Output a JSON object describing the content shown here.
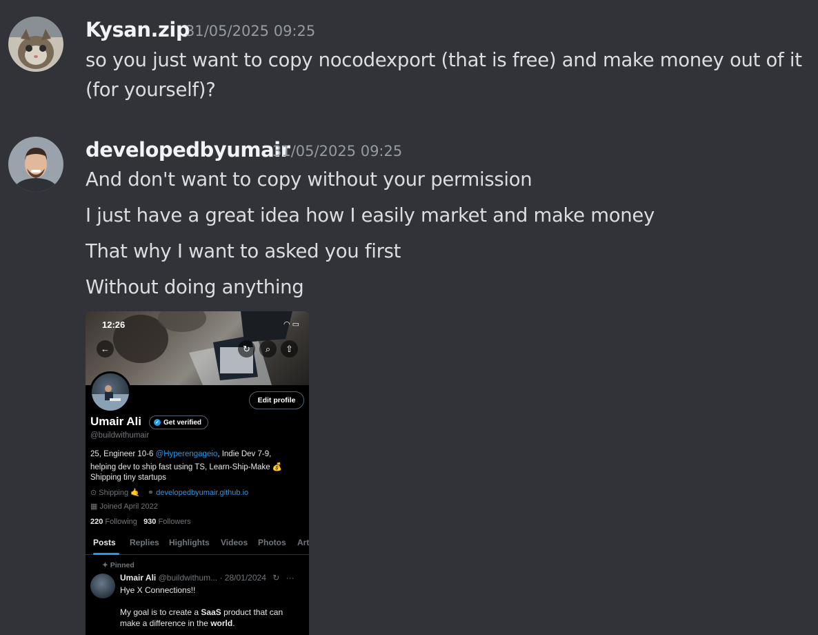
{
  "messages": [
    {
      "username": "Kysan.zip",
      "timestamp": "31/05/2025 09:25",
      "lines": [
        "so you just want to copy nocodexport (that is free) and make money out of it",
        "(for yourself)?"
      ]
    },
    {
      "username": "developedbyumair",
      "timestamp": "31/05/2025 09:25",
      "lines": [
        "And don't want to copy without your permission",
        "I just have a great idea how I easily market and make money",
        "That why I want to asked you first",
        "Without doing anything"
      ]
    }
  ],
  "attachment": {
    "status_time": "12:26",
    "edit_profile": "Edit profile",
    "name": "Umair Ali",
    "get_verified": "Get verified",
    "handle": "@buildwithumair",
    "bio": {
      "line1_pre": "25, Engineer 10-6 ",
      "line1_mention": "@Hyperengageio",
      "line1_post": ", Indie Dev 7-9,",
      "line2": "helping dev to ship fast using TS, Learn-Ship-Make 💰",
      "line3": "Shipping tiny startups"
    },
    "location": "Shipping 🤙",
    "website": "developedbyumair.github.io",
    "joined": "Joined April 2022",
    "following_count": "220",
    "following_label": "Following",
    "followers_count": "930",
    "followers_label": "Followers",
    "tabs": [
      "Posts",
      "Replies",
      "Highlights",
      "Videos",
      "Photos",
      "Art"
    ],
    "pinned_label": "Pinned",
    "post": {
      "name": "Umair Ali",
      "meta": "@buildwithum... · 28/01/2024",
      "line1": "Hye X Connections!!",
      "line2_pre": "My goal is to create a ",
      "line2_bold": "SaaS",
      "line2_post": " product that can",
      "line3_pre": "make a difference in the ",
      "line3_bold": "world",
      "line3_post": "."
    }
  }
}
